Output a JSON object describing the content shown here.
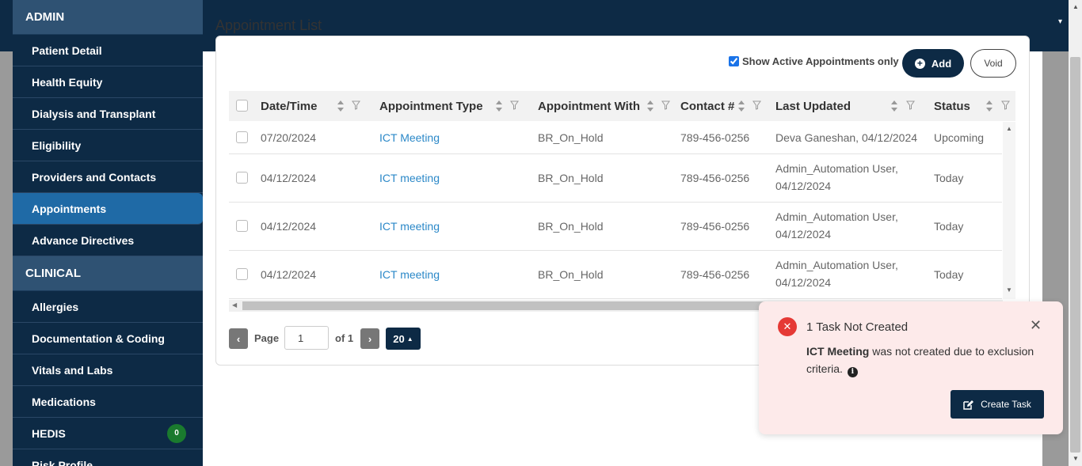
{
  "sidebar": {
    "sections": [
      {
        "title": "ADMIN"
      },
      {
        "title": "CLINICAL"
      }
    ],
    "admin_items": [
      {
        "label": "Patient Detail"
      },
      {
        "label": "Health Equity"
      },
      {
        "label": "Dialysis and Transplant"
      },
      {
        "label": "Eligibility"
      },
      {
        "label": "Providers and Contacts"
      },
      {
        "label": "Appointments",
        "active": true
      },
      {
        "label": "Advance Directives"
      }
    ],
    "clinical_items": [
      {
        "label": "Allergies"
      },
      {
        "label": "Documentation & Coding"
      },
      {
        "label": "Vitals and Labs"
      },
      {
        "label": "Medications"
      },
      {
        "label": "HEDIS",
        "badge": "0"
      },
      {
        "label": "Risk Profile"
      }
    ]
  },
  "main": {
    "title": "Appointment List",
    "show_active_label": "Show Active Appointments only",
    "show_active_checked": true,
    "add_label": "Add",
    "void_label": "Void"
  },
  "table": {
    "columns": [
      "Date/Time",
      "Appointment Type",
      "Appointment With",
      "Contact #",
      "Last Updated",
      "Status"
    ],
    "rows": [
      {
        "date": "07/20/2024",
        "type": "ICT Meeting",
        "with": "BR_On_Hold",
        "contact": "789-456-0256",
        "updated_1": "Deva Ganeshan, 04/12/2024",
        "updated_2": "",
        "status": "Upcoming"
      },
      {
        "date": "04/12/2024",
        "type": "ICT meeting",
        "with": "BR_On_Hold",
        "contact": "789-456-0256",
        "updated_1": "Admin_Automation User,",
        "updated_2": "04/12/2024",
        "status": "Today"
      },
      {
        "date": "04/12/2024",
        "type": "ICT meeting",
        "with": "BR_On_Hold",
        "contact": "789-456-0256",
        "updated_1": "Admin_Automation User,",
        "updated_2": "04/12/2024",
        "status": "Today"
      },
      {
        "date": "04/12/2024",
        "type": "ICT meeting",
        "with": "BR_On_Hold",
        "contact": "789-456-0256",
        "updated_1": "Admin_Automation User,",
        "updated_2": "04/12/2024",
        "status": "Today"
      }
    ]
  },
  "pagination": {
    "page_label": "Page",
    "page_value": "1",
    "of_label": "of 1",
    "page_size": "20"
  },
  "toast": {
    "title": "1 Task Not Created",
    "bold_text": "ICT Meeting",
    "message": " was not created due to exclusion criteria.",
    "button_label": "Create Task"
  },
  "colors": {
    "navy": "#0d2a45",
    "active_blue": "#1f6aa6",
    "link_blue": "#2b88c8",
    "error_red": "#e53935",
    "badge_green": "#1a7a2e",
    "toast_bg": "#fdeaea"
  },
  "icons": {
    "sort": "sort-icon",
    "filter": "filter-icon",
    "error": "error-x-icon",
    "close": "close-icon",
    "info": "info-icon",
    "edit": "edit-icon",
    "plus": "plus-circle-icon"
  }
}
